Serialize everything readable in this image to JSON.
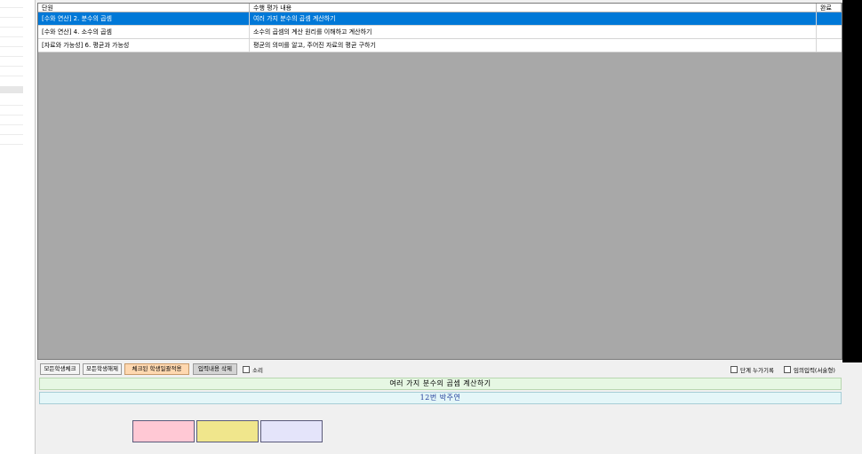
{
  "table": {
    "headers": [
      "단원",
      "수행 평가 내용",
      "완료"
    ],
    "rows": [
      {
        "unit": "[수와 연산] 2. 분수의 곱셈",
        "content": "여러 가지 분수의 곱셈 계산하기",
        "done": ""
      },
      {
        "unit": "[수와 연산] 4. 소수의 곱셈",
        "content": "소수의 곱셈의 계산 원리를 이해하고 계산하기",
        "done": ""
      },
      {
        "unit": "[자료와 가능성] 6. 평균과 가능성",
        "content": "평균의 의미를 알고, 주어진 자료의 평균 구하기",
        "done": ""
      }
    ]
  },
  "toolbar": {
    "check_all": "모든학생체크",
    "uncheck_all": "모든학생해제",
    "apply_checked": "체크된 학생일괄적용",
    "delete_input": "입력내용 삭제",
    "sound": "소리",
    "step_accumulate": "단계 누가기록",
    "free_input": "임의입력(서술형)"
  },
  "banner": {
    "title": "여러 가지 분수의 곱셈 계산하기",
    "student": "12번 박주연"
  },
  "swatches": [
    "#ffc8d4",
    "#f0e68c",
    "#e4e4fa"
  ]
}
